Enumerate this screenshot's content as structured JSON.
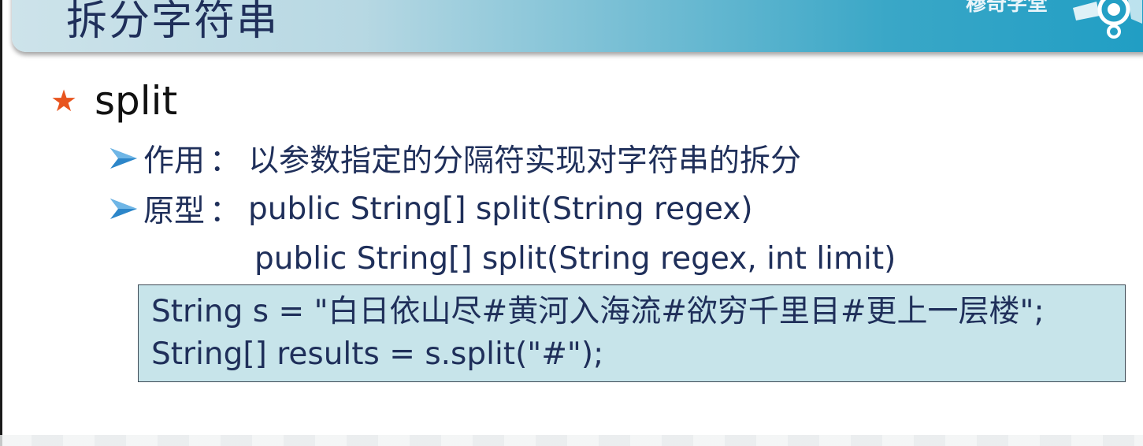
{
  "header": {
    "title": "拆分字符串",
    "brand": "穆奇学堂"
  },
  "section": {
    "heading": "split",
    "bullets": [
      {
        "label": "作用",
        "sep": "：",
        "text": "以参数指定的分隔符实现对字符串的拆分"
      },
      {
        "label": "原型",
        "sep": "：",
        "text": "public String[] split(String regex)"
      }
    ],
    "prototype_line2": "public String[] split(String regex, int limit)"
  },
  "code": {
    "lines": [
      "String s = \"白日依山尽#黄河入海流#欲穷千里目#更上一层楼\";",
      "String[] results = s.split(\"#\");"
    ]
  },
  "colors": {
    "title_text": "#1f2f5a",
    "star": "#e8541e",
    "arrow": "#2c86c9",
    "code_bg": "#c7e4ea"
  }
}
